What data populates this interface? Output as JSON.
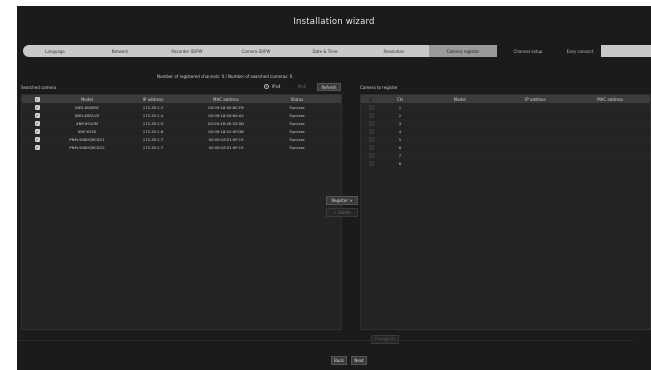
{
  "window": {
    "title": "Installation wizard"
  },
  "tabs": [
    {
      "label": "Language",
      "state": "done"
    },
    {
      "label": "Network",
      "state": "done"
    },
    {
      "label": "Recorder ID/PW",
      "state": "done"
    },
    {
      "label": "Camera ID/PW",
      "state": "done"
    },
    {
      "label": "Date & Time",
      "state": "done"
    },
    {
      "label": "Resolution",
      "state": "done"
    },
    {
      "label": "Camera register",
      "state": "active"
    },
    {
      "label": "Channel setup",
      "state": "future"
    },
    {
      "label": "Easy connect",
      "state": "future"
    }
  ],
  "registration_info": "Number of registered channels: 0 / Number of searched cameras: 6",
  "searched": {
    "label": "Searched camera",
    "ip_mode": {
      "ipv4_label": "IPv4",
      "ipv6_label": "IPv6",
      "selected": "IPv4"
    },
    "refresh_label": "Refresh",
    "headers": [
      "",
      "Model",
      "IP address",
      "MAC address",
      "Status"
    ],
    "rows": [
      {
        "checked": true,
        "model": "XND-6080RF",
        "ip": "172.30.1.3",
        "mac": "00:09:18:50:8C:F6",
        "status": "Success"
      },
      {
        "checked": true,
        "model": "XND-8081VZ",
        "ip": "172.30.1.4",
        "mac": "00:09:18:50:64:A2",
        "status": "Success"
      },
      {
        "checked": true,
        "model": "XNP-6010M",
        "ip": "172.30.1.5",
        "mac": "00:09:18:4E:52:0D",
        "status": "Success"
      },
      {
        "checked": true,
        "model": "XNP-6320",
        "ip": "172.30.1.6",
        "mac": "00:09:18:52:0F:DB",
        "status": "Success"
      },
      {
        "checked": true,
        "model": "PNM-9080QRCSG1",
        "ip": "172.30.1.7",
        "mac": "00:09:18:51:9F:19",
        "status": "Success"
      },
      {
        "checked": true,
        "model": "PNM-9080QRCSG2",
        "ip": "172.30.1.7",
        "mac": "00:09:18:51:9F:19",
        "status": "Success"
      }
    ]
  },
  "register": {
    "label": "Camera to register",
    "headers": [
      "",
      "CH",
      "Model",
      "IP address",
      "MAC address"
    ],
    "channels": [
      "1",
      "2",
      "3",
      "4",
      "5",
      "6",
      "7",
      "8"
    ]
  },
  "actions": {
    "register_label": "Register >",
    "delete_label": "< Delete",
    "change_label": "Change ID",
    "back_label": "Back",
    "next_label": "Next"
  }
}
